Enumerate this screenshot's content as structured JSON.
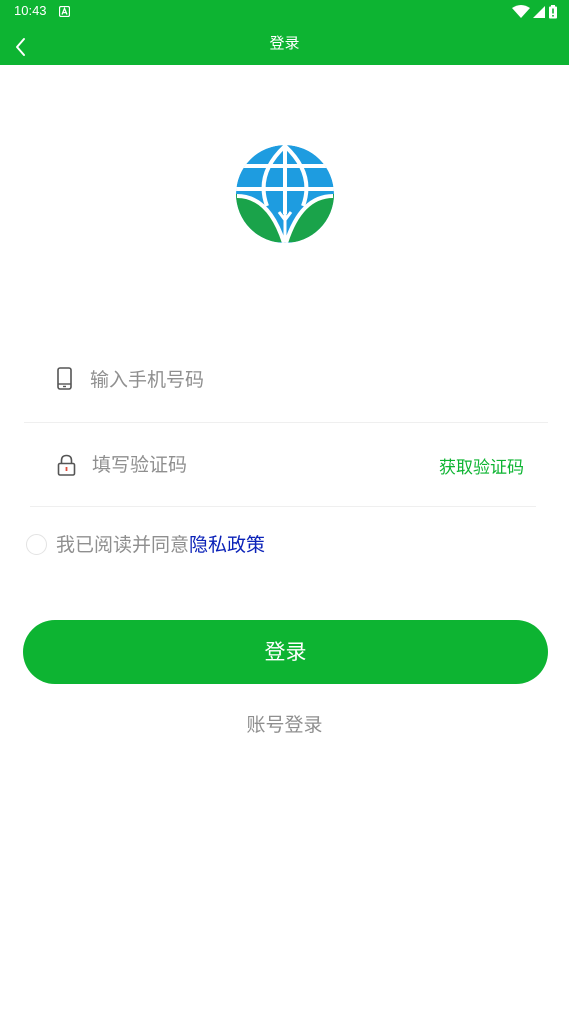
{
  "status_bar": {
    "time": "10:43",
    "bg_color": "#0db432",
    "icons": [
      "notification-a-icon",
      "wifi-icon",
      "signal-icon",
      "battery-icon"
    ]
  },
  "app_bar": {
    "title": "登录",
    "back_icon": "chevron-left-icon"
  },
  "logo": {
    "name": "globe-leaf-logo",
    "colors": {
      "globe": "#1e9ce0",
      "leaves": "#1aa34a"
    }
  },
  "form": {
    "phone": {
      "placeholder": "输入手机号码",
      "value": "",
      "icon": "phone-icon"
    },
    "code": {
      "placeholder": "填写验证码",
      "value": "",
      "icon": "lock-icon"
    },
    "get_code_label": "获取验证码"
  },
  "agreement": {
    "checked": false,
    "prefix": "我已阅读并同意",
    "link": "隐私政策"
  },
  "login_button": "登录",
  "account_login": "账号登录",
  "colors": {
    "primary": "#0db432",
    "link": "#0b22b8",
    "hint": "#8f8f8f"
  }
}
